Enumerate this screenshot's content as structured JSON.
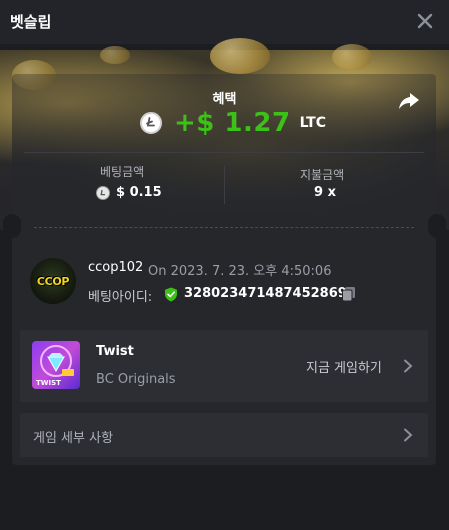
{
  "window": {
    "title": "벳슬립"
  },
  "reward": {
    "label": "혜택",
    "amount": "+$ 1.27",
    "currency": "LTC",
    "currency_icon": "litecoin-icon",
    "color": "#3bc117"
  },
  "stats": {
    "bet_amount_label": "베팅금액",
    "bet_amount_value": "$ 0.15",
    "payout_label": "지불금액",
    "payout_value": "9 x"
  },
  "bet": {
    "avatar_text": "CCOP",
    "username": "ccop102",
    "datetime": "On 2023. 7. 23. 오후 4:50:06",
    "bet_id_label": "베팅아이디:",
    "bet_id": "328023471487452869"
  },
  "game": {
    "name": "Twist",
    "provider": "BC Originals",
    "thumb_label": "TWIST",
    "play_label": "지금 게임하기"
  },
  "details": {
    "label": "게임 세부 사항"
  },
  "icons": [
    "close-icon",
    "share-icon",
    "litecoin-icon",
    "shield-check-icon",
    "copy-icon",
    "chevron-right-icon"
  ]
}
